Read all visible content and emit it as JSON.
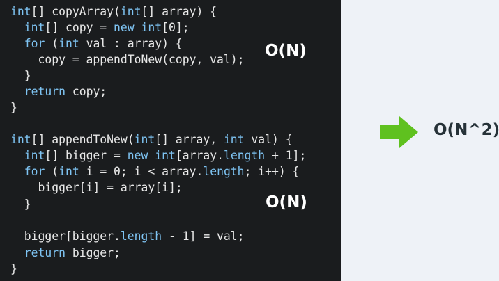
{
  "code": {
    "lines": [
      [
        {
          "t": "int",
          "kw": true
        },
        {
          "t": "[] copyArray("
        },
        {
          "t": "int",
          "kw": true
        },
        {
          "t": "[] array) {"
        }
      ],
      [
        {
          "t": "  "
        },
        {
          "t": "int",
          "kw": true
        },
        {
          "t": "[] copy = "
        },
        {
          "t": "new",
          "kw": true
        },
        {
          "t": " "
        },
        {
          "t": "int",
          "kw": true
        },
        {
          "t": "[0];"
        }
      ],
      [
        {
          "t": "  "
        },
        {
          "t": "for",
          "kw": true
        },
        {
          "t": " ("
        },
        {
          "t": "int",
          "kw": true
        },
        {
          "t": " val : array) {"
        }
      ],
      [
        {
          "t": "    copy = appendToNew(copy, val);"
        }
      ],
      [
        {
          "t": "  }"
        }
      ],
      [
        {
          "t": "  "
        },
        {
          "t": "return",
          "kw": true
        },
        {
          "t": " copy;"
        }
      ],
      [
        {
          "t": "}"
        }
      ],
      [
        {
          "t": ""
        }
      ],
      [
        {
          "t": "int",
          "kw": true
        },
        {
          "t": "[] appendToNew("
        },
        {
          "t": "int",
          "kw": true
        },
        {
          "t": "[] array, "
        },
        {
          "t": "int",
          "kw": true
        },
        {
          "t": " val) {"
        }
      ],
      [
        {
          "t": "  "
        },
        {
          "t": "int",
          "kw": true
        },
        {
          "t": "[] bigger = "
        },
        {
          "t": "new",
          "kw": true
        },
        {
          "t": " "
        },
        {
          "t": "int",
          "kw": true
        },
        {
          "t": "[array."
        },
        {
          "t": "length",
          "kw": true
        },
        {
          "t": " + 1];"
        }
      ],
      [
        {
          "t": "  "
        },
        {
          "t": "for",
          "kw": true
        },
        {
          "t": " ("
        },
        {
          "t": "int",
          "kw": true
        },
        {
          "t": " i = 0; i < array."
        },
        {
          "t": "length",
          "kw": true
        },
        {
          "t": "; i++) {"
        }
      ],
      [
        {
          "t": "    bigger[i] = array[i];"
        }
      ],
      [
        {
          "t": "  }"
        }
      ],
      [
        {
          "t": ""
        }
      ],
      [
        {
          "t": "  bigger[bigger."
        },
        {
          "t": "length",
          "kw": true
        },
        {
          "t": " - 1] = val;"
        }
      ],
      [
        {
          "t": "  "
        },
        {
          "t": "return",
          "kw": true
        },
        {
          "t": " bigger;"
        }
      ],
      [
        {
          "t": "}"
        }
      ]
    ]
  },
  "annotations": {
    "copy_complexity": "O(N)",
    "append_complexity": "O(N)",
    "total_complexity": "O(N^2)"
  },
  "colors": {
    "keyword": "#7ec3f2",
    "arrow": "#5fc11f"
  },
  "icons": {
    "arrow": "right-arrow-icon"
  }
}
